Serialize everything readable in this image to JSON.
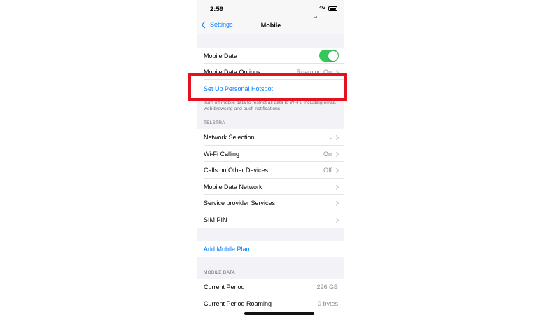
{
  "status_bar": {
    "time": "2:59",
    "network": "4G"
  },
  "nav": {
    "back_label": "Settings",
    "title": "Mobile"
  },
  "section1": {
    "mobile_data": {
      "label": "Mobile Data",
      "on": true
    },
    "mobile_data_options": {
      "label": "Mobile Data Options",
      "value": "Roaming On"
    },
    "personal_hotspot": {
      "label": "Set Up Personal Hotspot"
    },
    "footer": "Turn off mobile data to restrict all data to Wi-Fi, including email, web browsing and push notifications."
  },
  "section2": {
    "header": "TELSTRA",
    "items": [
      {
        "label": "Network Selection",
        "value": "."
      },
      {
        "label": "Wi-Fi Calling",
        "value": "On"
      },
      {
        "label": "Calls on Other Devices",
        "value": "Off"
      },
      {
        "label": "Mobile Data Network",
        "value": ""
      },
      {
        "label": "Service provider Services",
        "value": ""
      },
      {
        "label": "SIM PIN",
        "value": ""
      }
    ]
  },
  "add_plan": {
    "label": "Add Mobile Plan"
  },
  "section3": {
    "header": "MOBILE DATA",
    "items": [
      {
        "label": "Current Period",
        "value": "296 GB"
      },
      {
        "label": "Current Period Roaming",
        "value": "0 bytes"
      }
    ]
  },
  "colors": {
    "accent": "#007aff",
    "toggle_on": "#34c759",
    "highlight": "#e4121f"
  }
}
